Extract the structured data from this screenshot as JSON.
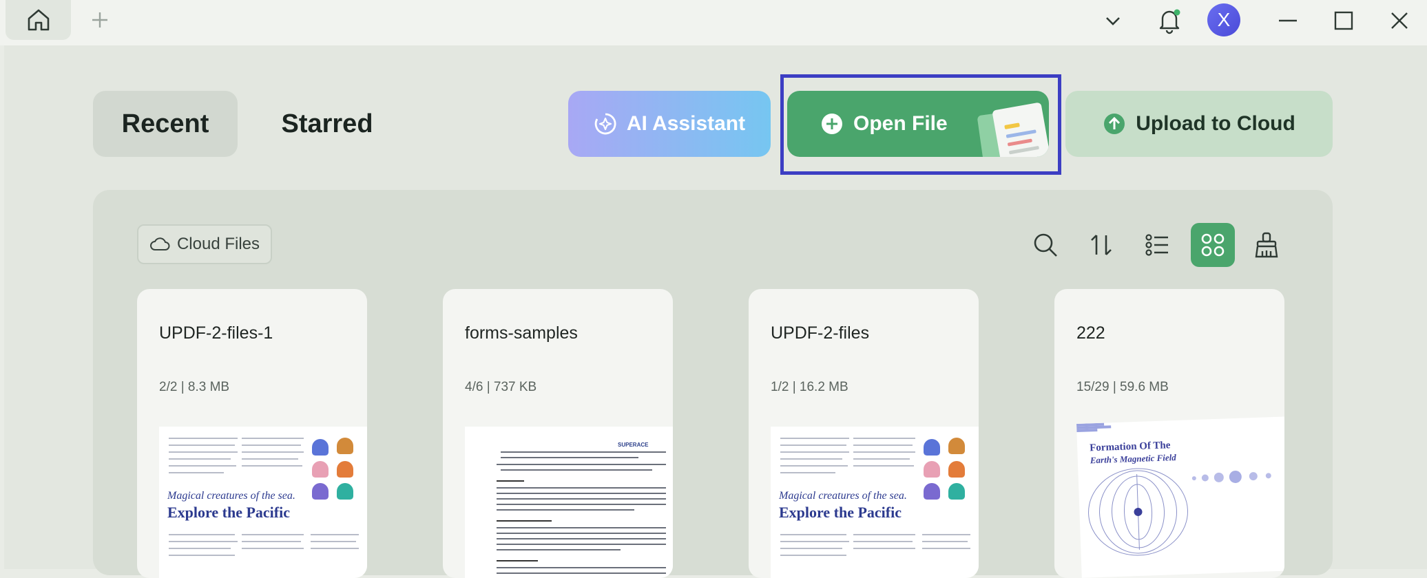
{
  "toolbar": {
    "avatar_letter": "X"
  },
  "tabs": {
    "recent": "Recent",
    "starred": "Starred"
  },
  "actions": {
    "ai_assistant": "AI Assistant",
    "open_file": "Open File",
    "upload_to_cloud": "Upload to Cloud"
  },
  "panel": {
    "cloud_files": "Cloud Files"
  },
  "files": [
    {
      "name": "UPDF-2-files-1",
      "meta": "2/2 | 8.3 MB"
    },
    {
      "name": "forms-samples",
      "meta": "4/6 | 737 KB"
    },
    {
      "name": "UPDF-2-files",
      "meta": "1/2 | 16.2 MB"
    },
    {
      "name": "222",
      "meta": "15/29 | 59.6 MB"
    }
  ],
  "thumbnails": {
    "sea_italic": "Magical creatures of the sea.",
    "sea_title": "Explore the Pacific",
    "superace": "SUPERACE",
    "magnet_title": "Formation Of The",
    "magnet_sub": "Earth's Magnetic Field"
  },
  "colors": {
    "accent_green": "#4aa56c",
    "highlight_outline": "#3c3ec3",
    "avatar": "#5a5ee6"
  }
}
